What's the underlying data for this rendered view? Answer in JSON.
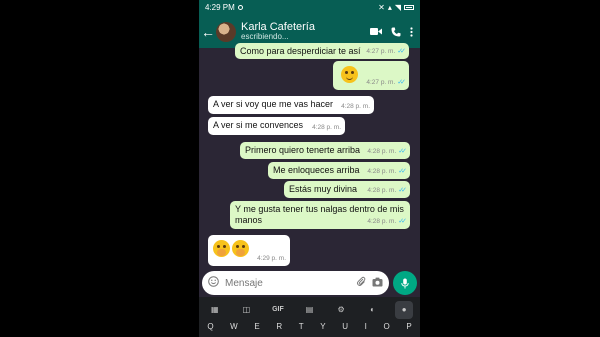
{
  "status_bar": {
    "time": "4:29 PM"
  },
  "header": {
    "contact_name": "Karla Cafetería",
    "contact_status": "escribiendo..."
  },
  "messages": [
    {
      "text": "Como para desperdiciar te así",
      "time": "4:27 p. m.",
      "dir": "out"
    },
    {
      "text": "",
      "time": "4:27 p. m.",
      "dir": "out",
      "emoji": "smirk-emoji"
    },
    {
      "text": "A ver si voy que me vas hacer",
      "time": "4:28 p. m.",
      "dir": "in"
    },
    {
      "text": "A ver si me convences",
      "time": "4:28 p. m.",
      "dir": "in"
    },
    {
      "text": "Primero quiero tenerte arriba",
      "time": "4:28 p. m.",
      "dir": "out"
    },
    {
      "text": "Me enloqueces arriba",
      "time": "4:28 p. m.",
      "dir": "out"
    },
    {
      "text": "Estás muy divina",
      "time": "4:28 p. m.",
      "dir": "out"
    },
    {
      "text": "Y me gusta tener tus nalgas dentro de mis manos",
      "time": "4:28 p. m.",
      "dir": "out"
    },
    {
      "text": "",
      "time": "4:29 p. m.",
      "dir": "in",
      "emoji": "blushing-emoji-pair"
    }
  ],
  "composer": {
    "placeholder": "Mensaje"
  },
  "keyboard": {
    "toolbar": [
      "apps-icon",
      "sticker-icon",
      "GIF",
      "clipboard-icon",
      "settings-icon",
      "palette-icon",
      "mic-icon"
    ],
    "top_row": [
      "Q",
      "W",
      "E",
      "R",
      "T",
      "Y",
      "U",
      "I",
      "O",
      "P"
    ]
  },
  "colors": {
    "header": "#075e54",
    "outgoing": "#dcf8c6",
    "incoming": "#ffffff",
    "read_ticks": "#34b7f1",
    "send_button": "#00a884"
  }
}
